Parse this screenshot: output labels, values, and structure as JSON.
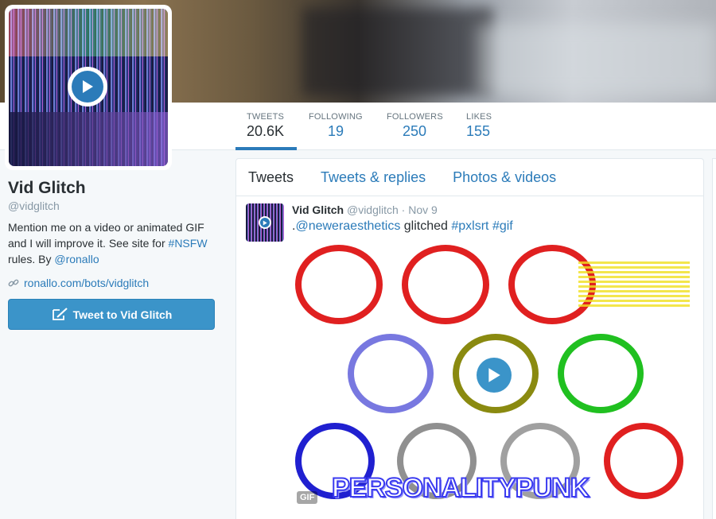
{
  "header": {
    "alt": "profile header image"
  },
  "nav": {
    "stats": [
      {
        "label": "TWEETS",
        "value": "20.6K"
      },
      {
        "label": "FOLLOWING",
        "value": "19"
      },
      {
        "label": "FOLLOWERS",
        "value": "250"
      },
      {
        "label": "LIKES",
        "value": "155"
      }
    ]
  },
  "profile": {
    "name": "Vid Glitch",
    "handle": "@vidglitch",
    "bio_prefix": "Mention me on a video or animated GIF and I will improve it. See site for ",
    "bio_tag": "#NSFW",
    "bio_mid": " rules. By ",
    "bio_link": "@ronallo",
    "url": "ronallo.com/bots/vidglitch",
    "tweet_button": "Tweet to Vid Glitch"
  },
  "timeline": {
    "tabs": [
      "Tweets",
      "Tweets & replies",
      "Photos & videos"
    ],
    "tweet": {
      "name": "Vid Glitch",
      "handle": "@vidglitch",
      "sep": " · ",
      "date": "Nov 9",
      "text_prefix": ".",
      "mention": "@neweraesthetics",
      "text_mid": " glitched ",
      "hashtag1": "#pxlsrt",
      "hashtag2": "#gif",
      "media_badge": "GIF",
      "media_caption": "PERSONALITYPUNK"
    }
  },
  "colors": {
    "accent": "#2b7bb9",
    "button": "#3b94c9"
  }
}
